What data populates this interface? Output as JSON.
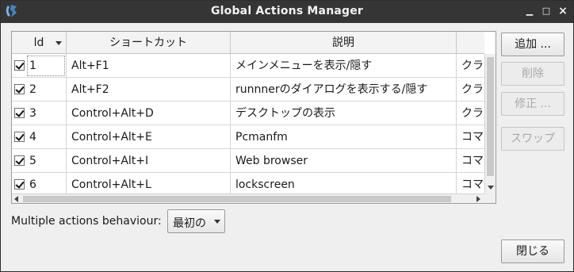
{
  "window": {
    "title": "Global Actions Manager",
    "minimize": "▁",
    "maximize": "□",
    "close": "×"
  },
  "table": {
    "headers": [
      "ld",
      "ショートカット",
      "説明",
      ""
    ],
    "rows": [
      {
        "checked": true,
        "id": "1",
        "shortcut": "Alt+F1",
        "description": "メインメニューを表示/隠す",
        "type": "クラ"
      },
      {
        "checked": true,
        "id": "2",
        "shortcut": "Alt+F2",
        "description": "runnnerのダイアログを表示する/隠す",
        "type": "クラ"
      },
      {
        "checked": true,
        "id": "3",
        "shortcut": "Control+Alt+D",
        "description": "デスクトップの表示",
        "type": "クラ"
      },
      {
        "checked": true,
        "id": "4",
        "shortcut": "Control+Alt+E",
        "description": "Pcmanfm",
        "type": "コマ"
      },
      {
        "checked": true,
        "id": "5",
        "shortcut": "Control+Alt+I",
        "description": "Web browser",
        "type": "コマ"
      },
      {
        "checked": true,
        "id": "6",
        "shortcut": "Control+Alt+L",
        "description": "lockscreen",
        "type": "コマ"
      }
    ]
  },
  "buttons": {
    "add": "追加 ...",
    "delete": "削除",
    "edit": "修正 ...",
    "swap": "スワップ",
    "close": "閉じる"
  },
  "behaviour": {
    "label": "Multiple actions behaviour:",
    "selected": "最初の"
  }
}
